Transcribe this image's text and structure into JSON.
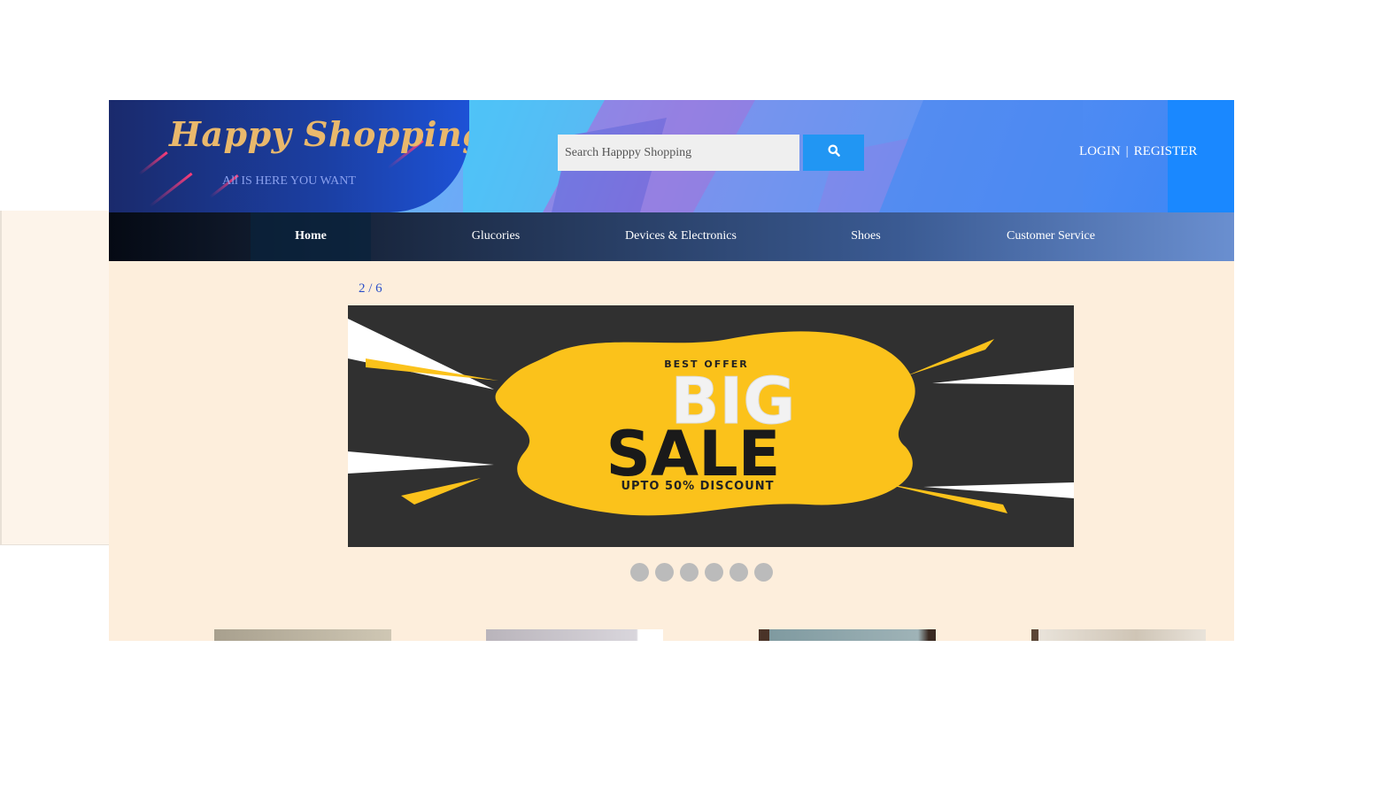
{
  "header": {
    "brand_title": "Happy Shopping",
    "tagline": "All IS HERE YOU WANT",
    "search": {
      "placeholder": "Search Happpy Shopping",
      "value": ""
    },
    "search_button_icon": "search-icon",
    "auth": {
      "login": "LOGIN",
      "separator": "|",
      "register": "REGISTER"
    }
  },
  "nav": {
    "items": [
      {
        "label": "Home",
        "active": true
      },
      {
        "label": "Glucories",
        "active": false
      },
      {
        "label": "Devices & Electronics",
        "active": false
      },
      {
        "label": "Shoes",
        "active": false
      },
      {
        "label": "Customer Service",
        "active": false
      }
    ]
  },
  "slideshow": {
    "counter": "2 / 6",
    "current": 2,
    "total": 6,
    "banner": {
      "eyebrow": "BEST OFFER",
      "line1": "BIG",
      "line2": "SALE",
      "subline": "UPTO 50% DISCOUNT"
    }
  },
  "colors": {
    "page_bg": "#fdeedc",
    "nav_dark": "#050a14",
    "accent_blue": "#2196f3",
    "brand_gold": "#e9b86c",
    "banner_yellow": "#fbc21b"
  }
}
